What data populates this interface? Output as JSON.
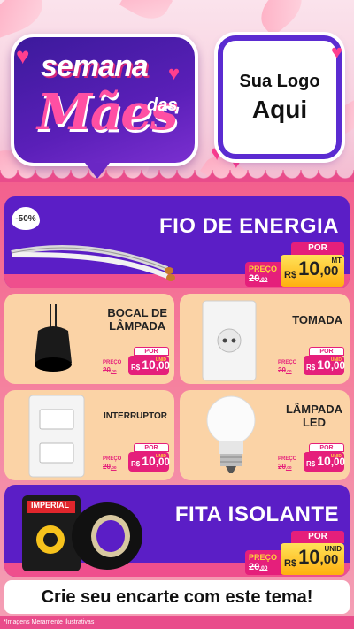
{
  "header": {
    "title_line1": "semana",
    "title_das": "das",
    "title_line2": "Mães",
    "logo_line1": "Sua Logo",
    "logo_line2": "Aqui"
  },
  "products": {
    "fio": {
      "name": "FIO DE ENERGIA",
      "badge": "-50%",
      "por": "POR",
      "preco": "PREÇO",
      "old": "20",
      "old_cents": ",00",
      "rs": "R$",
      "price": "10",
      "price_cents": ",00",
      "unit": "MT"
    },
    "bocal": {
      "name_line1": "BOCAL DE",
      "name_line2": "LÂMPADA",
      "por": "POR",
      "preco": "PREÇO",
      "old": "20",
      "old_cents": ",00",
      "rs": "R$",
      "price": "10",
      "price_cents": ",00",
      "unit": "UNID"
    },
    "tomada": {
      "name": "TOMADA",
      "por": "POR",
      "preco": "PREÇO",
      "old": "20",
      "old_cents": ",00",
      "rs": "R$",
      "price": "10",
      "price_cents": ",00",
      "unit": "UNID"
    },
    "interruptor": {
      "name": "INTERRUPTOR",
      "por": "POR",
      "preco": "PREÇO",
      "old": "20",
      "old_cents": ",00",
      "rs": "R$",
      "price": "10",
      "price_cents": ",00",
      "unit": "UNID"
    },
    "lampada": {
      "name_line1": "LÂMPADA",
      "name_line2": "LED",
      "por": "POR",
      "preco": "PREÇO",
      "old": "20",
      "old_cents": ",00",
      "rs": "R$",
      "price": "10",
      "price_cents": ",00",
      "unit": "UNID"
    },
    "fita": {
      "name": "FITA ISOLANTE",
      "brand": "IMPERIAL",
      "por": "POR",
      "preco": "PREÇO",
      "old": "20",
      "old_cents": ",00",
      "rs": "R$",
      "price": "10",
      "price_cents": ",00",
      "unit": "UNID"
    }
  },
  "cta": "Crie seu encarte com este tema!",
  "footnote": "*Imagens Meramente Ilustrativas",
  "colors": {
    "purple": "#5b1ec6",
    "pink": "#e51f7b",
    "peach": "#fbd3a6",
    "yellow": "#ffc526"
  }
}
